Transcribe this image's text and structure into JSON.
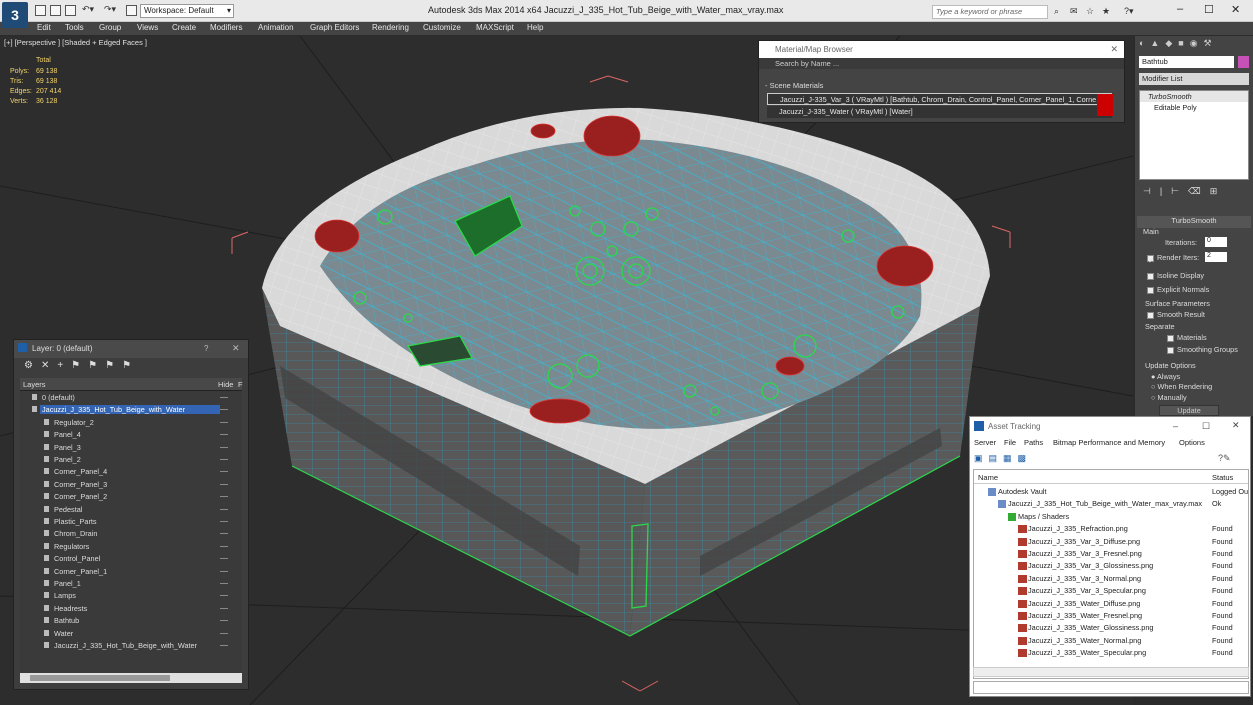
{
  "app": {
    "logo": "3",
    "title": "Autodesk 3ds Max  2014 x64      Jacuzzi_J_335_Hot_Tub_Beige_with_Water_max_vray.max",
    "workspace": "Workspace: Default",
    "search_placeholder": "Type a keyword or phrase"
  },
  "menu": [
    "Edit",
    "Tools",
    "Group",
    "Views",
    "Create",
    "Modifiers",
    "Animation",
    "Graph Editors",
    "Rendering",
    "Customize",
    "MAXScript",
    "Help"
  ],
  "viewport": {
    "label": "[+] [Perspective ] [Shaded + Edged Faces ]",
    "stats": {
      "total": "Total",
      "rows": [
        {
          "label": "Polys:",
          "value": "69 138"
        },
        {
          "label": "Tris:",
          "value": "69 138"
        },
        {
          "label": "Edges:",
          "value": "207 414"
        },
        {
          "label": "Verts:",
          "value": "36 128"
        }
      ]
    }
  },
  "layer_panel": {
    "title": "Layer: 0 (default)",
    "help": "?",
    "close": "✕",
    "col_layers": "Layers",
    "col_hide": "Hide",
    "col_extra": "F",
    "rows": [
      {
        "label": "0 (default)",
        "indent": 0
      },
      {
        "label": "Jacuzzi_J_335_Hot_Tub_Beige_with_Water",
        "indent": 0,
        "selected": true
      },
      {
        "label": "Regulator_2",
        "indent": 1
      },
      {
        "label": "Panel_4",
        "indent": 1
      },
      {
        "label": "Panel_3",
        "indent": 1
      },
      {
        "label": "Panel_2",
        "indent": 1
      },
      {
        "label": "Corner_Panel_4",
        "indent": 1
      },
      {
        "label": "Corner_Panel_3",
        "indent": 1
      },
      {
        "label": "Corner_Panel_2",
        "indent": 1
      },
      {
        "label": "Pedestal",
        "indent": 1
      },
      {
        "label": "Plastic_Parts",
        "indent": 1
      },
      {
        "label": "Chrom_Drain",
        "indent": 1
      },
      {
        "label": "Regulators",
        "indent": 1
      },
      {
        "label": "Control_Panel",
        "indent": 1
      },
      {
        "label": "Corner_Panel_1",
        "indent": 1
      },
      {
        "label": "Panel_1",
        "indent": 1
      },
      {
        "label": "Lamps",
        "indent": 1
      },
      {
        "label": "Headrests",
        "indent": 1
      },
      {
        "label": "Bathtub",
        "indent": 1
      },
      {
        "label": "Water",
        "indent": 1
      },
      {
        "label": "Jacuzzi_J_335_Hot_Tub_Beige_with_Water",
        "indent": 1
      }
    ]
  },
  "material_browser": {
    "title": "Material/Map Browser",
    "search_placeholder": "Search by Name ...",
    "section": "- Scene Materials",
    "rows": [
      "Jacuzzi_J-335_Var_3  ( VRayMtl )  [Bathtub, Chrom_Drain, Control_Panel, Corner_Panel_1, Corne...",
      "Jacuzzi_J-335_Water  ( VRayMtl )  [Water]"
    ]
  },
  "command_panel": {
    "object_name": "Bathtub",
    "modifier_list": "Modifier List",
    "stack": [
      "TurboSmooth",
      "Editable Poly"
    ],
    "rollout_title": "TurboSmooth",
    "main_label": "Main",
    "iterations_label": "Iterations:",
    "iterations_value": "0",
    "render_iters_label": "Render Iters:",
    "render_iters_value": "2",
    "isoline_label": "Isoline Display",
    "explicit_label": "Explicit Normals",
    "surface_label": "Surface Parameters",
    "smooth_result_label": "Smooth Result",
    "separate_label": "Separate",
    "materials_label": "Materials",
    "smoothing_label": "Smoothing Groups",
    "update_options_label": "Update Options",
    "always_label": "Always",
    "when_rendering_label": "When Rendering",
    "manually_label": "Manually",
    "update_button": "Update"
  },
  "asset_tracking": {
    "title": "Asset Tracking",
    "menu": [
      "Server",
      "File",
      "Paths",
      "Bitmap Performance and Memory",
      "Options"
    ],
    "col_name": "Name",
    "col_status": "Status",
    "rows": [
      {
        "name": "Autodesk Vault",
        "status": "Logged Ou",
        "indent": 0,
        "icon": "vault"
      },
      {
        "name": "Jacuzzi_J_335_Hot_Tub_Beige_with_Water_max_vray.max",
        "status": "Ok",
        "indent": 1,
        "icon": "max"
      },
      {
        "name": "Maps / Shaders",
        "status": "",
        "indent": 2,
        "icon": "maps"
      },
      {
        "name": "Jacuzzi_J_335_Refraction.png",
        "status": "Found",
        "indent": 3,
        "icon": "png"
      },
      {
        "name": "Jacuzzi_J_335_Var_3_Diffuse.png",
        "status": "Found",
        "indent": 3,
        "icon": "png"
      },
      {
        "name": "Jacuzzi_J_335_Var_3_Fresnel.png",
        "status": "Found",
        "indent": 3,
        "icon": "png"
      },
      {
        "name": "Jacuzzi_J_335_Var_3_Glossiness.png",
        "status": "Found",
        "indent": 3,
        "icon": "png"
      },
      {
        "name": "Jacuzzi_J_335_Var_3_Normal.png",
        "status": "Found",
        "indent": 3,
        "icon": "png"
      },
      {
        "name": "Jacuzzi_J_335_Var_3_Specular.png",
        "status": "Found",
        "indent": 3,
        "icon": "png"
      },
      {
        "name": "Jacuzzi_J_335_Water_Diffuse.png",
        "status": "Found",
        "indent": 3,
        "icon": "png"
      },
      {
        "name": "Jacuzzi_J_335_Water_Fresnel.png",
        "status": "Found",
        "indent": 3,
        "icon": "png"
      },
      {
        "name": "Jacuzzi_J_335_Water_Glossiness.png",
        "status": "Found",
        "indent": 3,
        "icon": "png"
      },
      {
        "name": "Jacuzzi_J_335_Water_Normal.png",
        "status": "Found",
        "indent": 3,
        "icon": "png"
      },
      {
        "name": "Jacuzzi_J_335_Water_Specular.png",
        "status": "Found",
        "indent": 3,
        "icon": "png"
      }
    ]
  },
  "colors": {
    "accent": "#3465b4",
    "viewport_bg": "#2d2d2d",
    "wire_white": "#f0f0f0",
    "wire_water": "#33b7d6",
    "wire_green": "#2bd94a",
    "wire_red": "#b51d1d",
    "stats_yellow": "#f2d46b"
  }
}
